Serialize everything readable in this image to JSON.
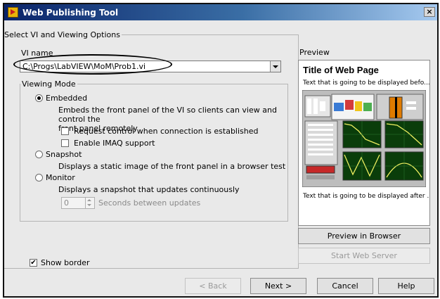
{
  "window": {
    "title": "Web Publishing Tool",
    "close_glyph": "×"
  },
  "select_group": {
    "legend": "Select VI and Viewing Options"
  },
  "vi_name": {
    "label": "VI name",
    "value": "C:\\Progs\\LabVIEW\\MoM\\Prob1.vi"
  },
  "viewing_mode": {
    "legend": "Viewing Mode",
    "selected": "Embedded",
    "embedded": {
      "label": "Embedded",
      "description_line1": "Embeds the front panel of the VI so clients can view and control the",
      "description_line2": "front panel remotely",
      "request_control_label": "Request control when connection is established",
      "request_control_checked": false,
      "imaq_label": "Enable IMAQ support",
      "imaq_checked": false
    },
    "snapshot": {
      "label": "Snapshot",
      "description": "Displays a static image of the front panel in a browser test"
    },
    "monitor": {
      "label": "Monitor",
      "description": "Displays a snapshot that updates continuously",
      "delay_value": "0",
      "delay_label": "Seconds between updates"
    }
  },
  "show_border": {
    "label": "Show border",
    "checked": true,
    "check_glyph": "✔"
  },
  "preview": {
    "legend": "Preview",
    "page_title": "Title of Web Page",
    "text_before": "Text that is going to be displayed befo...",
    "text_after": "Text that is going to be displayed after ..."
  },
  "buttons": {
    "preview_in_browser": "Preview in Browser",
    "start_web_server": "Start Web Server",
    "back": "< Back",
    "next": "Next >",
    "cancel": "Cancel",
    "help": "Help"
  },
  "colors": {
    "title_bar_start": "#0a246a",
    "title_bar_end": "#a6caf0",
    "dialog_bg": "#e9e9e9",
    "disabled_text": "#8a8a8a"
  }
}
